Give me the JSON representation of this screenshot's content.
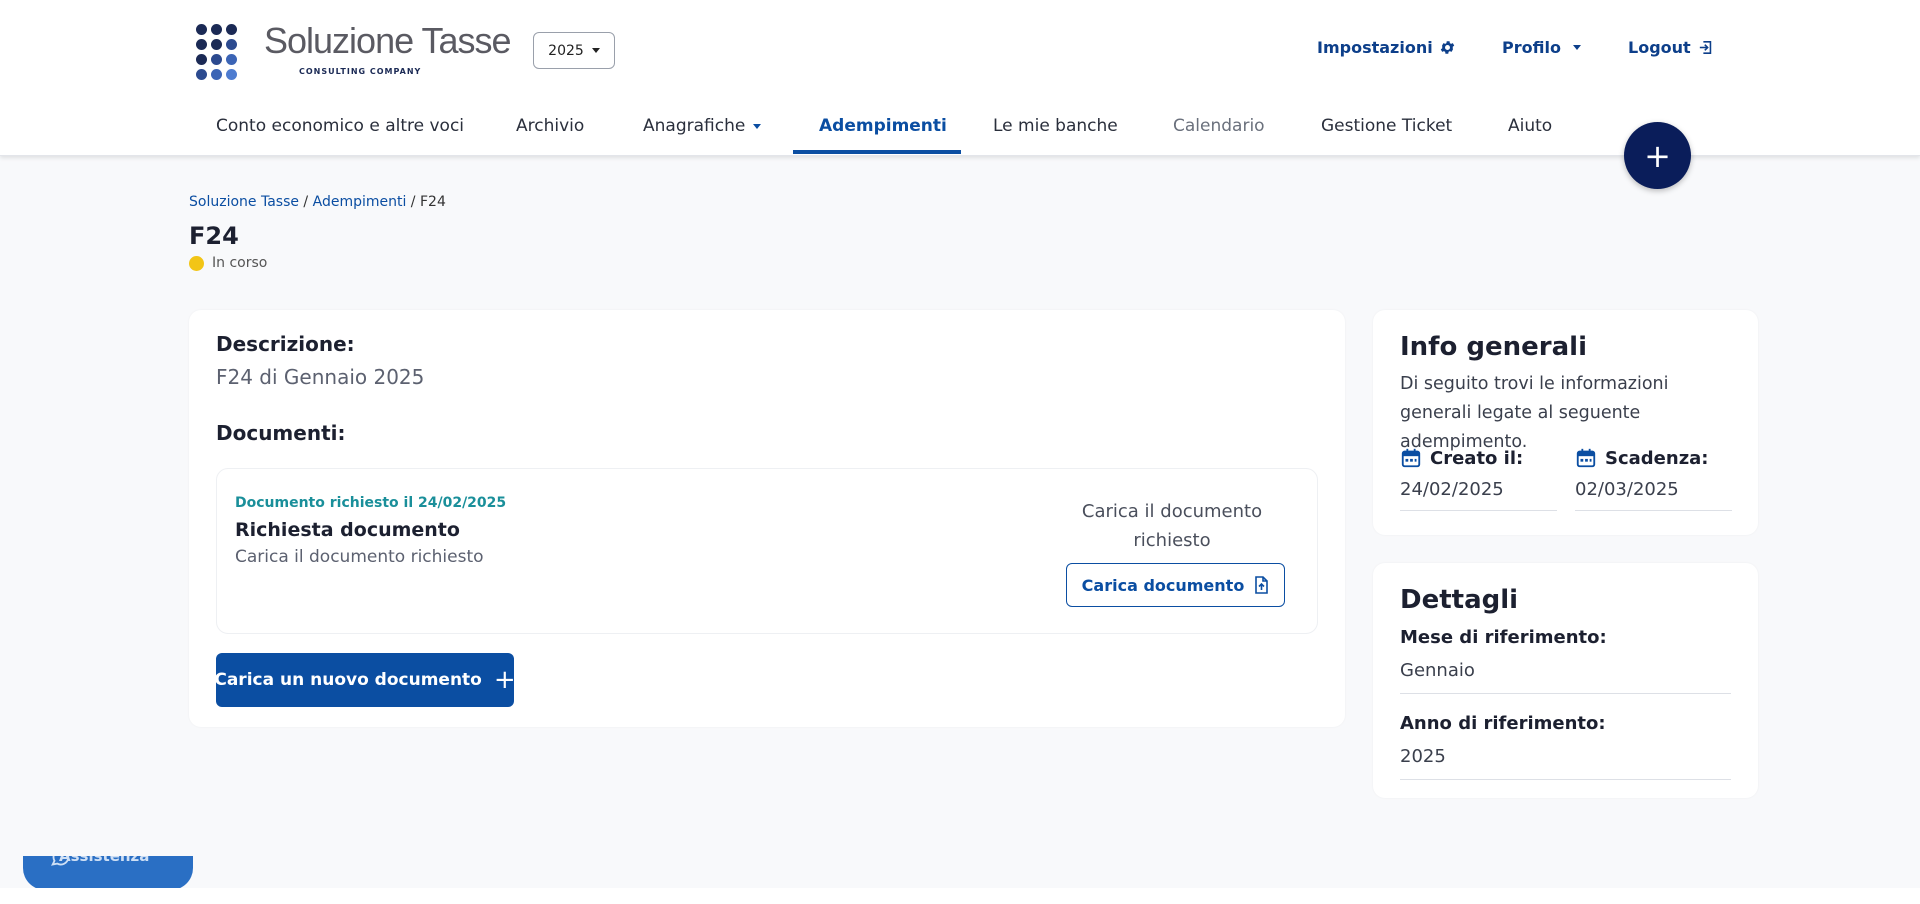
{
  "header": {
    "logo_name": "Soluzione Tasse",
    "logo_sub": "CONSULTING COMPANY",
    "year": "2025",
    "top_links": {
      "settings": "Impostazioni",
      "profile": "Profilo",
      "logout": "Logout"
    },
    "nav": [
      "Conto economico e altre voci",
      "Archivio",
      "Anagrafiche",
      "Adempimenti",
      "Le mie banche",
      "Calendario",
      "Gestione Ticket",
      "Aiuto"
    ],
    "active_nav": "Adempimenti",
    "fab_icon": "plus-icon"
  },
  "breadcrumb": {
    "root": "Soluzione Tasse",
    "section": "Adempimenti",
    "current": "F24",
    "separator": " / "
  },
  "page": {
    "title": "F24",
    "status": "In corso",
    "status_color": "#f2c516"
  },
  "main": {
    "description_label": "Descrizione:",
    "description_value": "F24 di Gennaio 2025",
    "documents_label": "Documenti:",
    "document": {
      "requested_on": "Documento richiesto il 24/02/2025",
      "name": "Richiesta documento",
      "description": "Carica il documento richiesto",
      "right_text": "Carica il documento richiesto",
      "upload_button": "Carica documento"
    },
    "new_document_button": "Carica un nuovo documento"
  },
  "info": {
    "title": "Info generali",
    "text": "Di seguito trovi le informazioni generali legate al seguente adempimento.",
    "created_label": "Creato il:",
    "created_value": "24/02/2025",
    "due_label": "Scadenza:",
    "due_value": "02/03/2025"
  },
  "details": {
    "title": "Dettagli",
    "month_label": "Mese di riferimento:",
    "month_value": "Gennaio",
    "year_label": "Anno di riferimento:",
    "year_value": "2025"
  },
  "assist": {
    "label": "Assistenza"
  },
  "colors": {
    "primary": "#0b4ea2",
    "navy": "#0a1d5a",
    "teal": "#1a8f9a",
    "background": "#f8f9fb"
  }
}
